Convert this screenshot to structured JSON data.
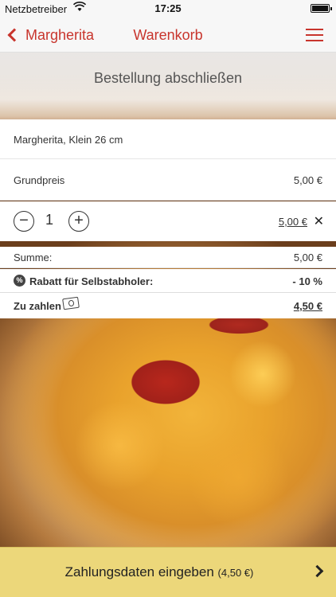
{
  "statusbar": {
    "carrier": "Netzbetreiber",
    "wifi_icon": "wifi-icon",
    "time": "17:25",
    "battery_icon": "battery-icon"
  },
  "navbar": {
    "back_label": "Margherita",
    "title": "Warenkorb",
    "menu_icon": "hamburger-menu-icon"
  },
  "section_title": "Bestellung abschließen",
  "cart": {
    "product": "Margherita, Klein 26 cm",
    "base_price_label": "Grundpreis",
    "base_price_value": "5,00 €",
    "quantity": "1",
    "line_total": "5,00 €"
  },
  "summary": {
    "sum_label": "Summe:",
    "sum_value": "5,00 €",
    "discount_label": "Rabatt für Selbstabholer:",
    "discount_value": "- 10 %",
    "pay_label": "Zu zahlen",
    "pay_value": "4,50 €"
  },
  "checkout": {
    "label": "Zahlungsdaten eingeben",
    "amount": "(4,50 €)"
  },
  "colors": {
    "accent": "#c8352d",
    "button_bg": "#ecd77a"
  }
}
